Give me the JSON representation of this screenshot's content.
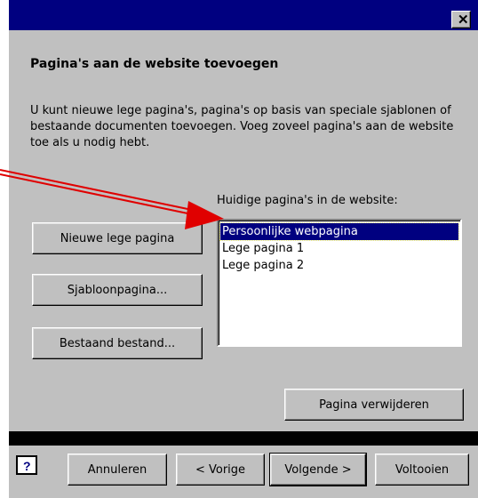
{
  "window": {
    "close_glyph": "✕"
  },
  "page": {
    "heading": "Pagina's aan de website toevoegen",
    "description": "U kunt nieuwe lege pagina's, pagina's op basis van speciale sjablonen of bestaande documenten toevoegen. Voeg zoveel pagina's aan de website toe als u nodig hebt."
  },
  "actions": {
    "new_blank_page": "Nieuwe lege pagina",
    "template_page": "Sjabloonpagina...",
    "existing_file": "Bestaand bestand...",
    "remove_page": "Pagina verwijderen"
  },
  "pages_list": {
    "label": "Huidige pagina's in de website:",
    "items": [
      "Persoonlijke webpagina",
      "Lege pagina 1",
      "Lege pagina 2"
    ],
    "selected_index": 0
  },
  "footer": {
    "help_glyph": "?",
    "cancel": "Annuleren",
    "back": "< Vorige",
    "next": "Volgende >",
    "finish": "Voltooien"
  },
  "colors": {
    "titlebar": "#000080",
    "dialog_bg": "#c0c0c0",
    "annotation_arrow": "#e00000",
    "selection": "#000080"
  }
}
